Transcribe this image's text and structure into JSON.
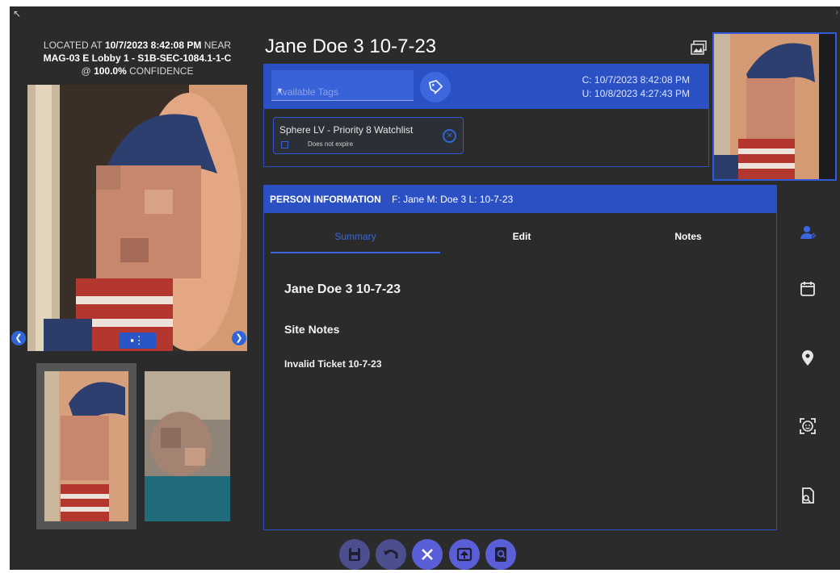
{
  "window": {
    "located": {
      "prefix": "LOCATED AT",
      "datetime": "10/7/2023 8:42:08 PM",
      "near": "NEAR",
      "location": "MAG-03 E Lobby 1 - S1B-SEC-1084.1-1-C",
      "at": "@",
      "confidence": "100.0%",
      "confidence_label": "CONFIDENCE"
    },
    "person_title": "Jane Doe 3 10-7-23",
    "tag_bar": {
      "select_placeholder": "Available Tags",
      "created": "C: 10/7/2023 8:42:08 PM",
      "updated": "U: 10/8/2023 4:27:43 PM"
    },
    "tag_chip": {
      "name": "Sphere LV - Priority 8 Watchlist",
      "expiry": "Does not expire"
    },
    "person_info": {
      "header_label": "PERSON INFORMATION",
      "name_summary": "F: Jane M: Doe 3 L: 10-7-23",
      "tabs": [
        "Summary",
        "Edit",
        "Notes"
      ],
      "summary_title": "Jane Doe 3 10-7-23",
      "site_notes_heading": "Site Notes",
      "note": "Invalid Ticket 10-7-23"
    },
    "side_icons": [
      "person-icon",
      "calendar-icon",
      "location-pin-icon",
      "face-scan-icon",
      "document-search-icon"
    ],
    "bottom_buttons": [
      "save-icon",
      "undo-icon",
      "close-icon",
      "transfer-icon",
      "inspect-icon"
    ],
    "colors": {
      "background": "#2b2b2b",
      "accent_blue": "#2a50c4",
      "active_tab": "#3b66e0",
      "button_purple": "#5a5fd8"
    }
  }
}
